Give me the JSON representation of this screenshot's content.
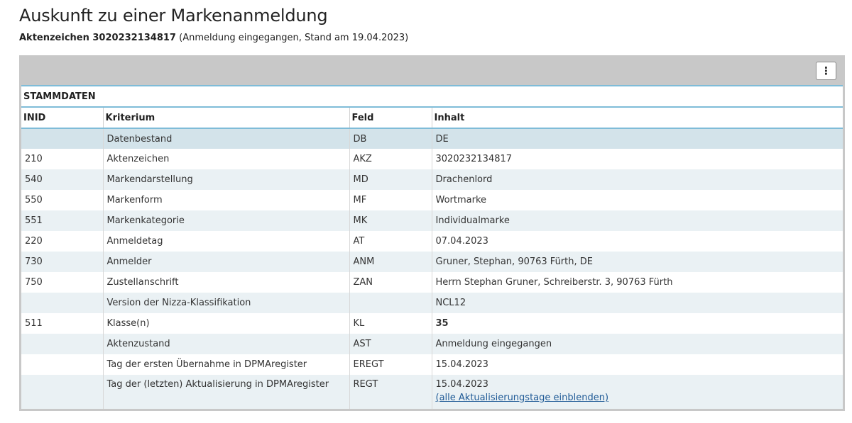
{
  "header": {
    "title": "Auskunft zu einer Markenanmeldung",
    "file_label": "Aktenzeichen 3020232134817",
    "status_text": "(Anmeldung eingegangen, Stand am 19.04.2023)"
  },
  "toolbar": {
    "menu_icon": "⋮"
  },
  "section": {
    "title": "STAMMDATEN"
  },
  "table": {
    "headers": [
      "INID",
      "Kriterium",
      "Feld",
      "Inhalt"
    ],
    "rows": [
      {
        "inid": "",
        "kriterium": "Datenbestand",
        "feld": "DB",
        "inhalt": "DE"
      },
      {
        "inid": "210",
        "kriterium": "Aktenzeichen",
        "feld": "AKZ",
        "inhalt": "3020232134817"
      },
      {
        "inid": "540",
        "kriterium": "Markendarstellung",
        "feld": "MD",
        "inhalt": "Drachenlord"
      },
      {
        "inid": "550",
        "kriterium": "Markenform",
        "feld": "MF",
        "inhalt": "Wortmarke"
      },
      {
        "inid": "551",
        "kriterium": "Markenkategorie",
        "feld": "MK",
        "inhalt": "Individualmarke"
      },
      {
        "inid": "220",
        "kriterium": "Anmeldetag",
        "feld": "AT",
        "inhalt": "07.04.2023"
      },
      {
        "inid": "730",
        "kriterium": "Anmelder",
        "feld": "ANM",
        "inhalt": "Gruner, Stephan, 90763 Fürth, DE"
      },
      {
        "inid": "750",
        "kriterium": "Zustellanschrift",
        "feld": "ZAN",
        "inhalt": "Herrn Stephan Gruner, Schreiberstr. 3, 90763 Fürth"
      },
      {
        "inid": "",
        "kriterium": "Version der Nizza-Klassifikation",
        "feld": "",
        "inhalt": "NCL12"
      },
      {
        "inid": "511",
        "kriterium": "Klasse(n)",
        "feld": "KL",
        "inhalt": "35"
      },
      {
        "inid": "",
        "kriterium": "Aktenzustand",
        "feld": "AST",
        "inhalt": "Anmeldung eingegangen"
      },
      {
        "inid": "",
        "kriterium": "Tag der ersten Übernahme in DPMAregister",
        "feld": "EREGT",
        "inhalt": "15.04.2023"
      },
      {
        "inid": "",
        "kriterium": "Tag der (letzten) Aktualisierung in DPMAregister",
        "feld": "REGT",
        "inhalt": "15.04.2023",
        "link": "(alle Aktualisierungstage einblenden)"
      }
    ]
  }
}
